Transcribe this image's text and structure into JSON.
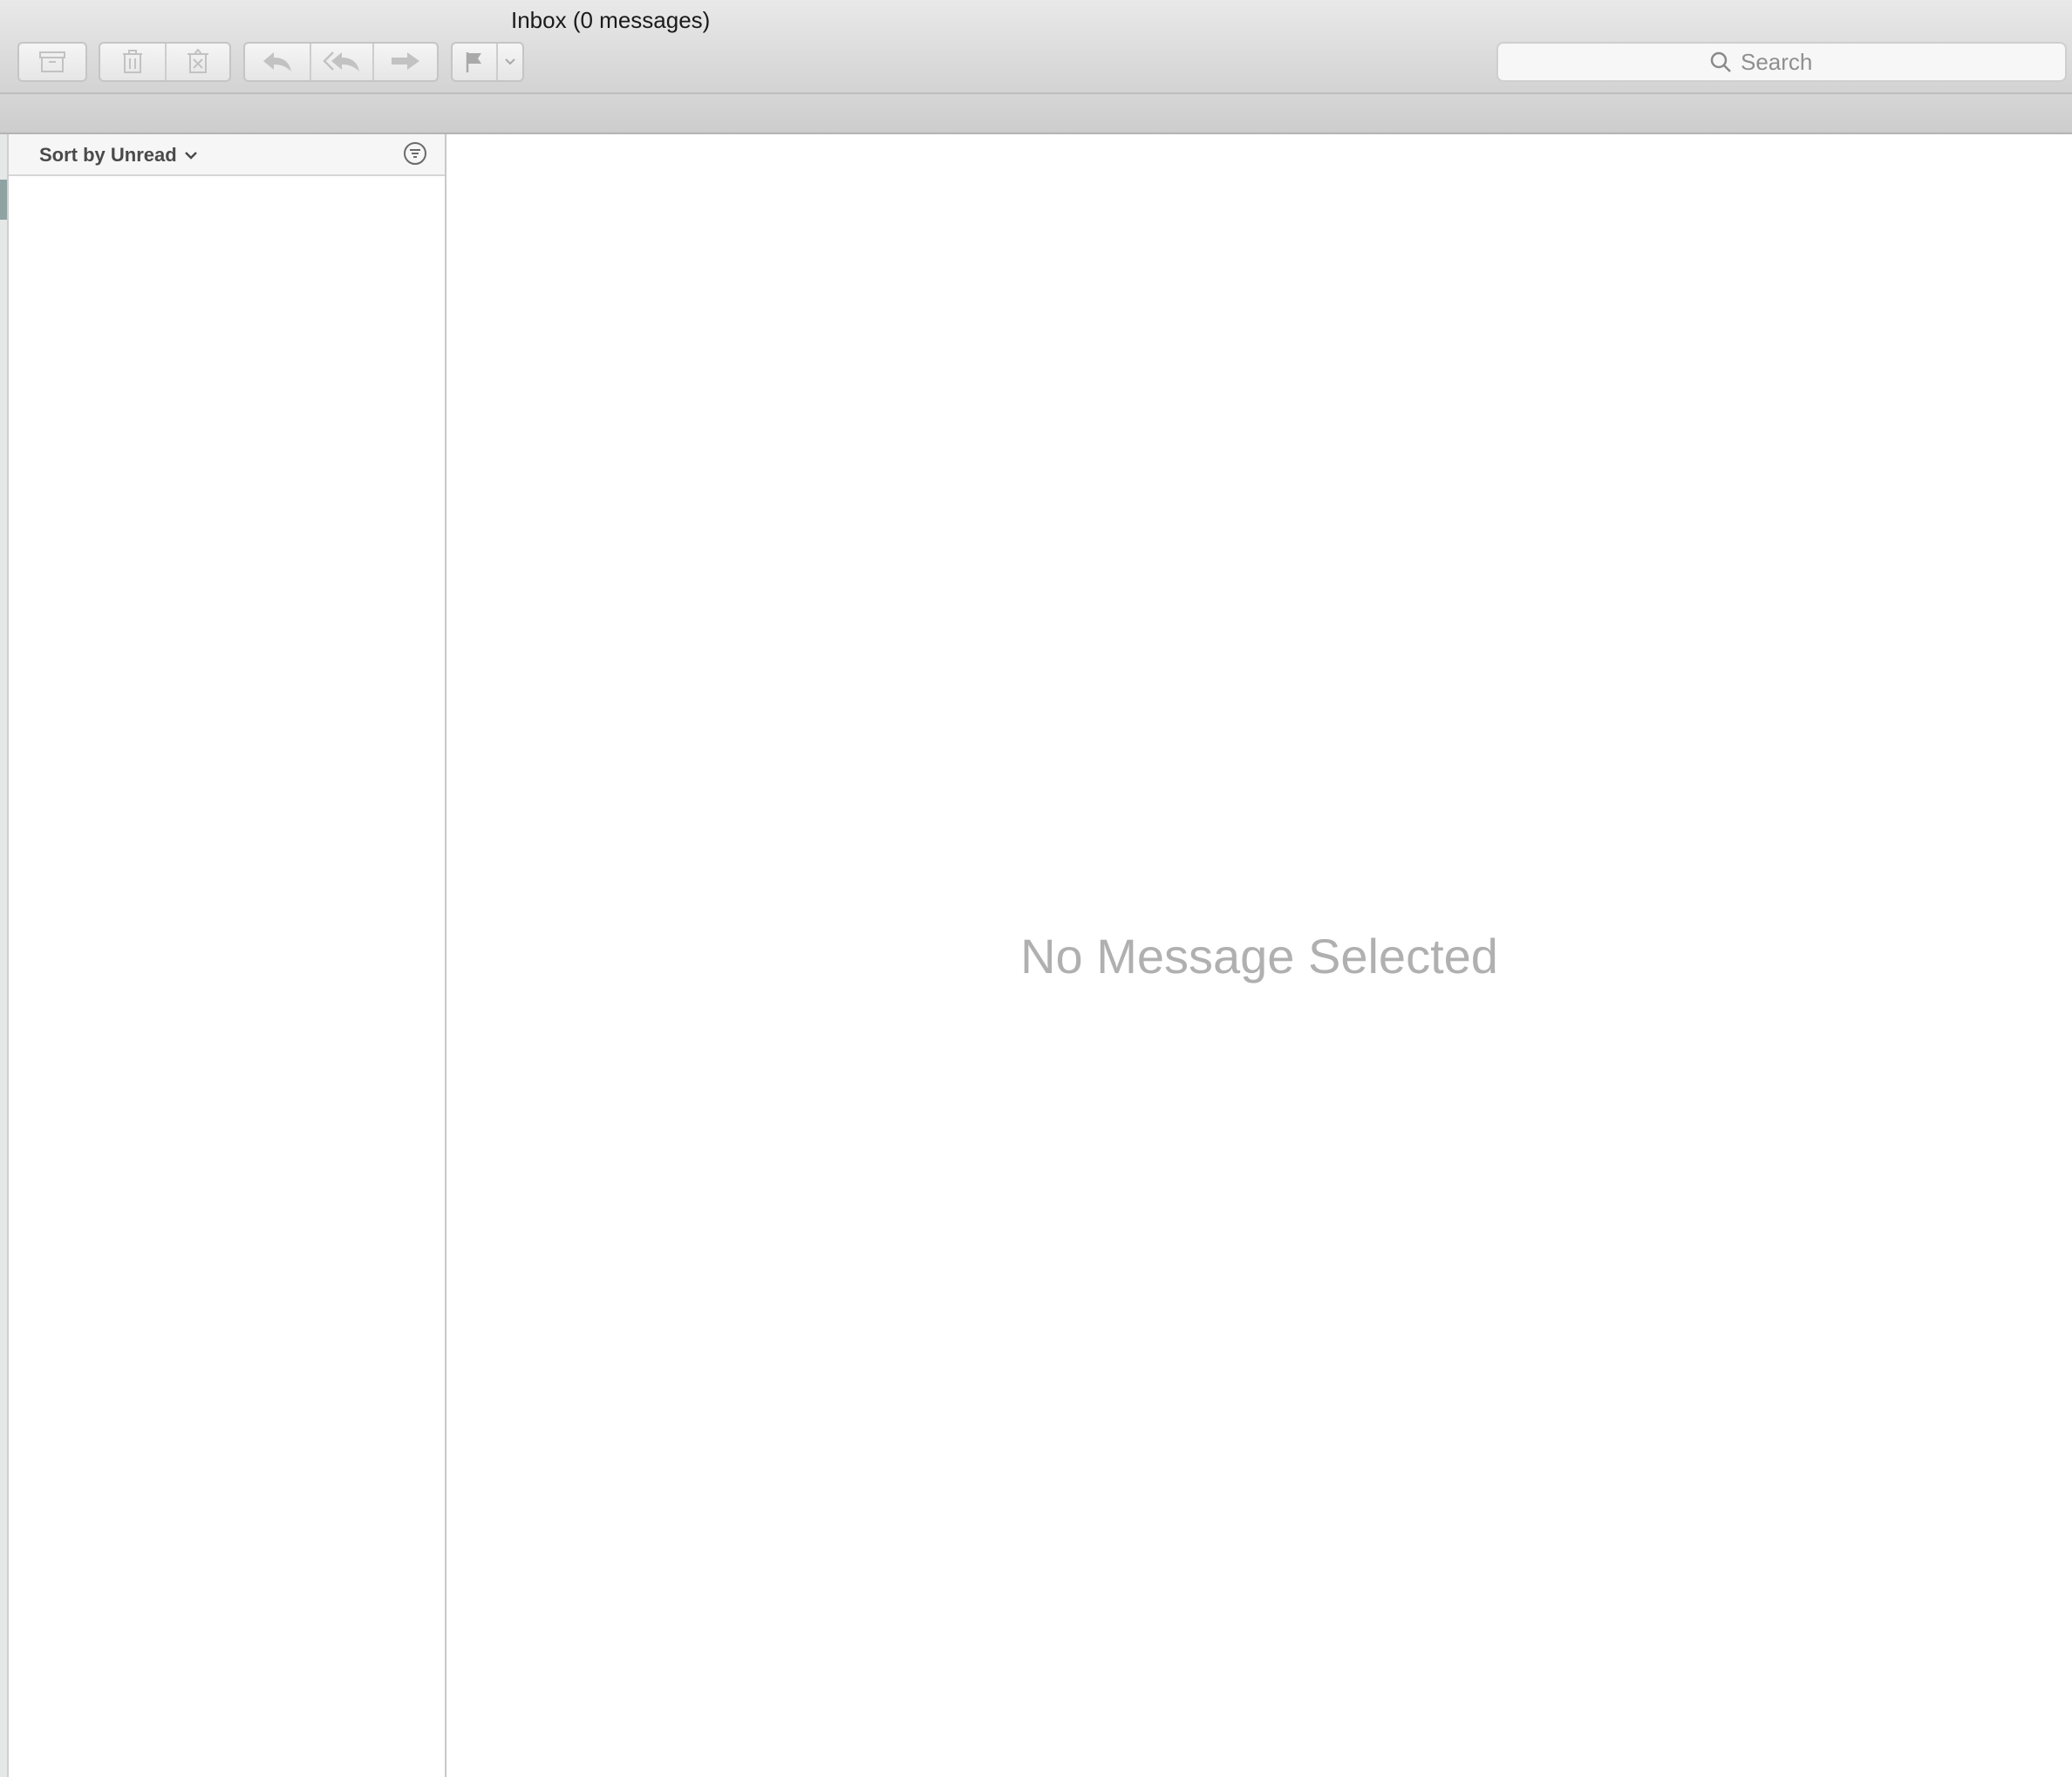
{
  "window": {
    "title": "Inbox (0 messages)"
  },
  "toolbar": {
    "buttons": [
      {
        "name": "archive",
        "icon": "archive-box-icon"
      },
      {
        "name": "delete",
        "icon": "trash-icon"
      },
      {
        "name": "junk",
        "icon": "junk-icon"
      },
      {
        "name": "reply",
        "icon": "reply-arrow-icon"
      },
      {
        "name": "reply-all",
        "icon": "reply-all-arrow-icon"
      },
      {
        "name": "forward",
        "icon": "forward-arrow-icon"
      },
      {
        "name": "flag",
        "icon": "flag-icon"
      },
      {
        "name": "flag-menu",
        "icon": "chevron-down-icon"
      }
    ],
    "search": {
      "placeholder": "Search"
    }
  },
  "message_list": {
    "sort_label": "Sort by Unread",
    "messages": []
  },
  "preview": {
    "empty_text": "No Message Selected"
  },
  "colors": {
    "toolbar_top": "#e9e9e9",
    "toolbar_bottom": "#d3d3d3",
    "icon_disabled": "#b8b8b8",
    "empty_text": "#b0b0b0",
    "sidebar_marker": "#8fa3a3"
  }
}
